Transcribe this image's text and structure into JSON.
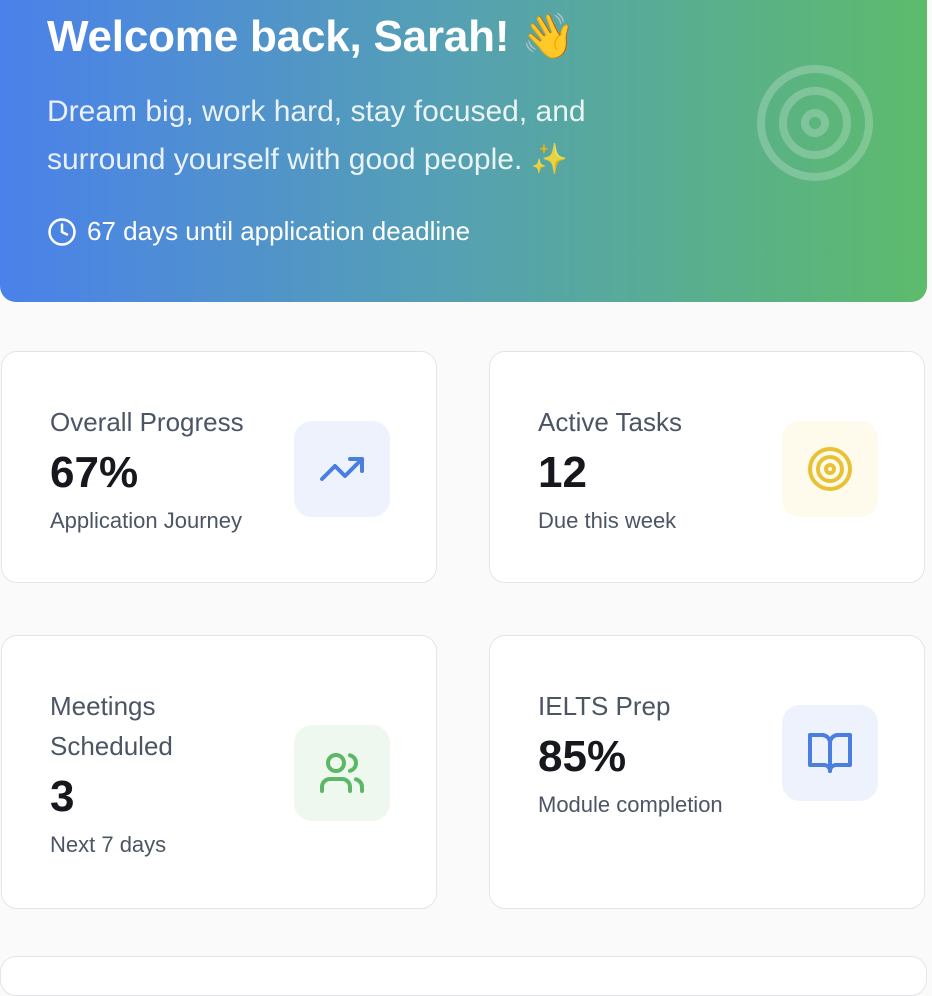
{
  "hero": {
    "title": "Welcome back, Sarah! 👋",
    "quote": "Dream big, work hard, stay focused, and surround yourself with good people. ✨",
    "deadline": "67 days until application deadline",
    "colors": {
      "gradient_start": "#4a81ea",
      "gradient_end": "#5dbb6c"
    },
    "icons": [
      "clock-icon",
      "target-icon"
    ]
  },
  "stats": [
    {
      "label": "Overall Progress",
      "value": "67%",
      "sub": "Application Journey",
      "icon": "trending-up-icon",
      "icon_bg": "#eef2fd",
      "icon_color": "#4a7fe0"
    },
    {
      "label": "Active Tasks",
      "value": "12",
      "sub": "Due this week",
      "icon": "target-icon",
      "icon_bg": "#fefaec",
      "icon_color": "#e8c234"
    },
    {
      "label": "Meetings Scheduled",
      "value": "3",
      "sub": "Next 7 days",
      "icon": "users-icon",
      "icon_bg": "#eef8ef",
      "icon_color": "#5cb867"
    },
    {
      "label": "IELTS Prep",
      "value": "85%",
      "sub": "Module completion",
      "icon": "book-open-icon",
      "icon_bg": "#eef2fd",
      "icon_color": "#4a7fe0"
    }
  ]
}
